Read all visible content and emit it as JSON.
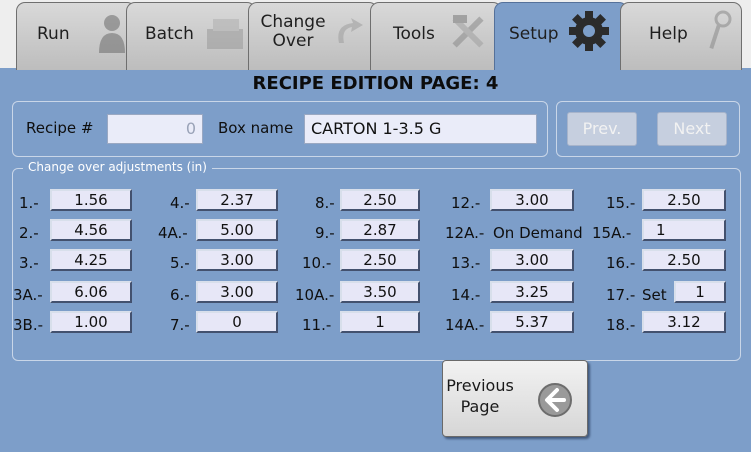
{
  "tabs": [
    {
      "label": "Run",
      "icon": "person-icon"
    },
    {
      "label": "Batch",
      "icon": "stack-icon"
    },
    {
      "label": "Change\nOver",
      "icon": "change-over-icon"
    },
    {
      "label": "Tools",
      "icon": "tools-icon"
    },
    {
      "label": "Setup",
      "icon": "gear-icon"
    },
    {
      "label": "Help",
      "icon": "magnifier-icon"
    }
  ],
  "active_tab": "Setup",
  "page_title": "RECIPE EDITION PAGE: 4",
  "recipe": {
    "recipe_label": "Recipe #",
    "recipe_value": "0",
    "box_name_label": "Box name",
    "box_name_value": "CARTON 1-3.5 G"
  },
  "nav": {
    "prev_label": "Prev.",
    "next_label": "Next"
  },
  "adjustments": {
    "legend": "Change over adjustments (in)",
    "columns": [
      [
        {
          "label": "1.-",
          "value": "1.56"
        },
        {
          "label": "2.-",
          "value": "4.56"
        },
        {
          "label": "3.-",
          "value": "4.25"
        },
        {
          "label": "3A.-",
          "value": "6.06"
        },
        {
          "label": "3B.-",
          "value": "1.00"
        }
      ],
      [
        {
          "label": "4.-",
          "value": "2.37"
        },
        {
          "label": "4A.-",
          "value": "5.00"
        },
        {
          "label": "5.-",
          "value": "3.00"
        },
        {
          "label": "6.-",
          "value": "3.00"
        },
        {
          "label": "7.-",
          "value": "0"
        }
      ],
      [
        {
          "label": "8.-",
          "value": "2.50"
        },
        {
          "label": "9.-",
          "value": "2.87"
        },
        {
          "label": "10.-",
          "value": "2.50"
        },
        {
          "label": "10A.-",
          "value": "3.50"
        },
        {
          "label": "11.-",
          "value": "1"
        }
      ],
      [
        {
          "label": "12.-",
          "value": "3.00"
        },
        {
          "label": "12A.-",
          "value": "On Demand"
        },
        {
          "label": "13.-",
          "value": "3.00"
        },
        {
          "label": "14.-",
          "value": "3.25"
        },
        {
          "label": "14A.-",
          "value": "5.37"
        }
      ],
      [
        {
          "label": "15.-",
          "value": "2.50"
        },
        {
          "label": "15A.-",
          "value": "1"
        },
        {
          "label": "16.-",
          "value": "2.50"
        },
        {
          "label": "17.-",
          "value": "1",
          "prefix": "Set"
        },
        {
          "label": "18.-",
          "value": "3.12"
        }
      ]
    ]
  },
  "previous_page": {
    "label": "Previous\nPage",
    "icon": "back-arrow-icon"
  },
  "colors": {
    "background": "#7d9ec9",
    "tab_inactive": "#c8c8c8",
    "field": "#e7e7f7"
  }
}
